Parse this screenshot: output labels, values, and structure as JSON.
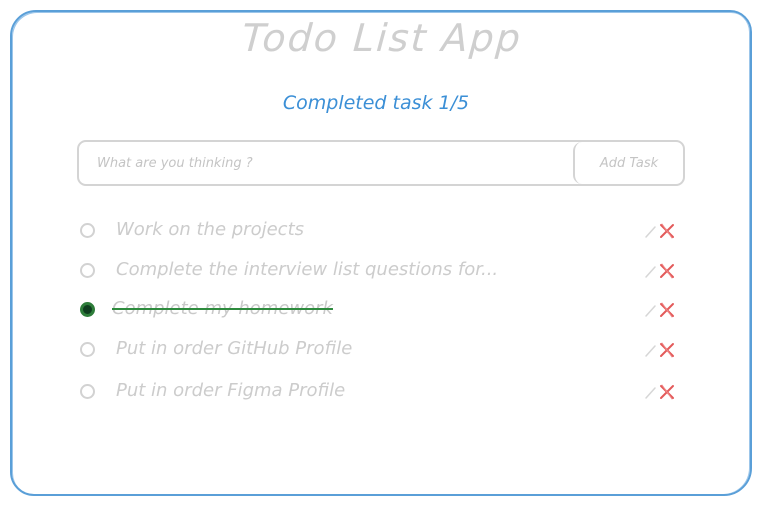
{
  "app": {
    "title": "Todo List App",
    "progress_text": "Completed task 1/5"
  },
  "input": {
    "placeholder": "What are you thinking ?",
    "value": "",
    "add_label": "Add Task"
  },
  "tasks": [
    {
      "label": "Work on the projects",
      "completed": false
    },
    {
      "label": "Complete the interview list questions for...",
      "completed": false
    },
    {
      "label": "Complete my homework",
      "completed": true
    },
    {
      "label": "Put in order GitHub Profile",
      "completed": false
    },
    {
      "label": "Put in order Figma Profile",
      "completed": false
    }
  ],
  "colors": {
    "accent": "#3b8fd6",
    "border": "#5a9fd8",
    "muted_text": "#cccccc",
    "done_strike": "#2e8b3e",
    "done_check": "#0f3d1f",
    "delete": "#e35a5a"
  },
  "icons": {
    "edit": "pencil-icon",
    "delete": "x-icon",
    "check": "radio-icon"
  }
}
